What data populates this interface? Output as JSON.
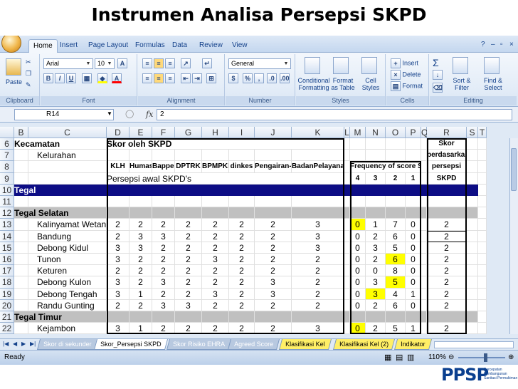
{
  "slide_title": "Instrumen Analisa Persepsi SKPD",
  "ribbon_tabs": [
    "Home",
    "Insert",
    "Page Layout",
    "Formulas",
    "Data",
    "Review",
    "View"
  ],
  "ribbon": {
    "paste": "Paste",
    "clipboard": "Clipboard",
    "font_name": "Arial",
    "font_size": "10",
    "font": "Font",
    "alignment": "Alignment",
    "number_format": "General",
    "number": "Number",
    "conditional_formatting": "Conditional Formatting",
    "format_as_table": "Format as Table",
    "cell_styles": "Cell Styles",
    "styles": "Styles",
    "insert": "Insert",
    "delete": "Delete",
    "format": "Format",
    "cells": "Cells",
    "sort_filter": "Sort & Filter",
    "find_select": "Find & Select",
    "editing": "Editing"
  },
  "formula_bar": {
    "name_box": "R14",
    "fx": "fx",
    "value": "2"
  },
  "columns": [
    "B",
    "C",
    "D",
    "E",
    "F",
    "G",
    "H",
    "I",
    "J",
    "K",
    "L",
    "M",
    "N",
    "O",
    "P",
    "Q",
    "R",
    "S",
    "T"
  ],
  "row_numbers": [
    "6",
    "7",
    "8",
    "9",
    "10",
    "11",
    "12",
    "13",
    "14",
    "15",
    "16",
    "17",
    "18",
    "19",
    "20",
    "21",
    "22"
  ],
  "header": {
    "kecamatan": "Kecamatan",
    "kelurahan": "Kelurahan",
    "skor_oleh": "Skor oleh SKPD",
    "persepsi_awal": "Persepsi awal SKPD's",
    "skpd_cols": [
      "KLH",
      "Humas",
      "Bappeda",
      "DPTRK",
      "BPMPKB",
      "dinkes",
      "Pengairan-PU",
      "BadanPelayananPT"
    ],
    "frequency": "Frequency of score SKPD",
    "freq_cols": [
      "4",
      "3",
      "2",
      "1"
    ],
    "skor_lines": [
      "Skor",
      "berdasarkan",
      "persepsi",
      "SKPD"
    ]
  },
  "groups": {
    "tegal": "Tegal",
    "tegal_selatan": "Tegal Selatan",
    "tegal_timur": "Tegal Timur"
  },
  "rows": [
    {
      "name": "Kalinyamat Wetan",
      "scores": [
        "2",
        "2",
        "2",
        "2",
        "2",
        "2",
        "2",
        "3"
      ],
      "freq": [
        "0",
        "1",
        "7",
        "0"
      ],
      "skor": "2"
    },
    {
      "name": "Bandung",
      "scores": [
        "2",
        "3",
        "3",
        "2",
        "2",
        "2",
        "2",
        "3"
      ],
      "freq": [
        "0",
        "2",
        "6",
        "0"
      ],
      "skor": "2"
    },
    {
      "name": "Debong Kidul",
      "scores": [
        "3",
        "3",
        "2",
        "2",
        "2",
        "2",
        "2",
        "3"
      ],
      "freq": [
        "0",
        "3",
        "5",
        "0"
      ],
      "skor": "2"
    },
    {
      "name": "Tunon",
      "scores": [
        "3",
        "2",
        "2",
        "2",
        "3",
        "2",
        "2",
        "2"
      ],
      "freq": [
        "0",
        "2",
        "6",
        "0"
      ],
      "skor": "2"
    },
    {
      "name": "Keturen",
      "scores": [
        "2",
        "2",
        "2",
        "2",
        "2",
        "2",
        "2",
        "2"
      ],
      "freq": [
        "0",
        "0",
        "8",
        "0"
      ],
      "skor": "2"
    },
    {
      "name": "Debong Kulon",
      "scores": [
        "3",
        "2",
        "3",
        "2",
        "2",
        "2",
        "3",
        "2"
      ],
      "freq": [
        "0",
        "3",
        "5",
        "0"
      ],
      "skor": "2"
    },
    {
      "name": "Debong Tengah",
      "scores": [
        "3",
        "1",
        "2",
        "2",
        "3",
        "2",
        "3",
        "2"
      ],
      "freq": [
        "0",
        "3",
        "4",
        "1"
      ],
      "skor": "2"
    },
    {
      "name": "Randu Gunting",
      "scores": [
        "2",
        "2",
        "3",
        "3",
        "2",
        "2",
        "2",
        "2"
      ],
      "freq": [
        "0",
        "2",
        "6",
        "0"
      ],
      "skor": "2"
    }
  ],
  "partial_row": {
    "name": "Kejambon",
    "scores": [
      "3",
      "1",
      "2",
      "2",
      "2",
      "2",
      "2",
      "3"
    ],
    "freq": [
      "0",
      "2",
      "5",
      "1"
    ],
    "skor": "2"
  },
  "sheet_tabs": [
    "Skor di sekunder",
    "Skor_Persepsi SKPD",
    "Skor Risiko EHRA",
    "Agreed Score",
    "Klasifikasi Kel",
    "Klasifikasi Kel (2)",
    "Indikator"
  ],
  "status": {
    "ready": "Ready",
    "zoom": "110%"
  },
  "logo": {
    "text": "PPSP",
    "sub": "Percepatan Pembangunan Sanitasi Permukiman"
  },
  "colors": {
    "navy_band": "#0d0d85",
    "group_grey": "#c0c0c0",
    "highlight": "#ffff00"
  }
}
